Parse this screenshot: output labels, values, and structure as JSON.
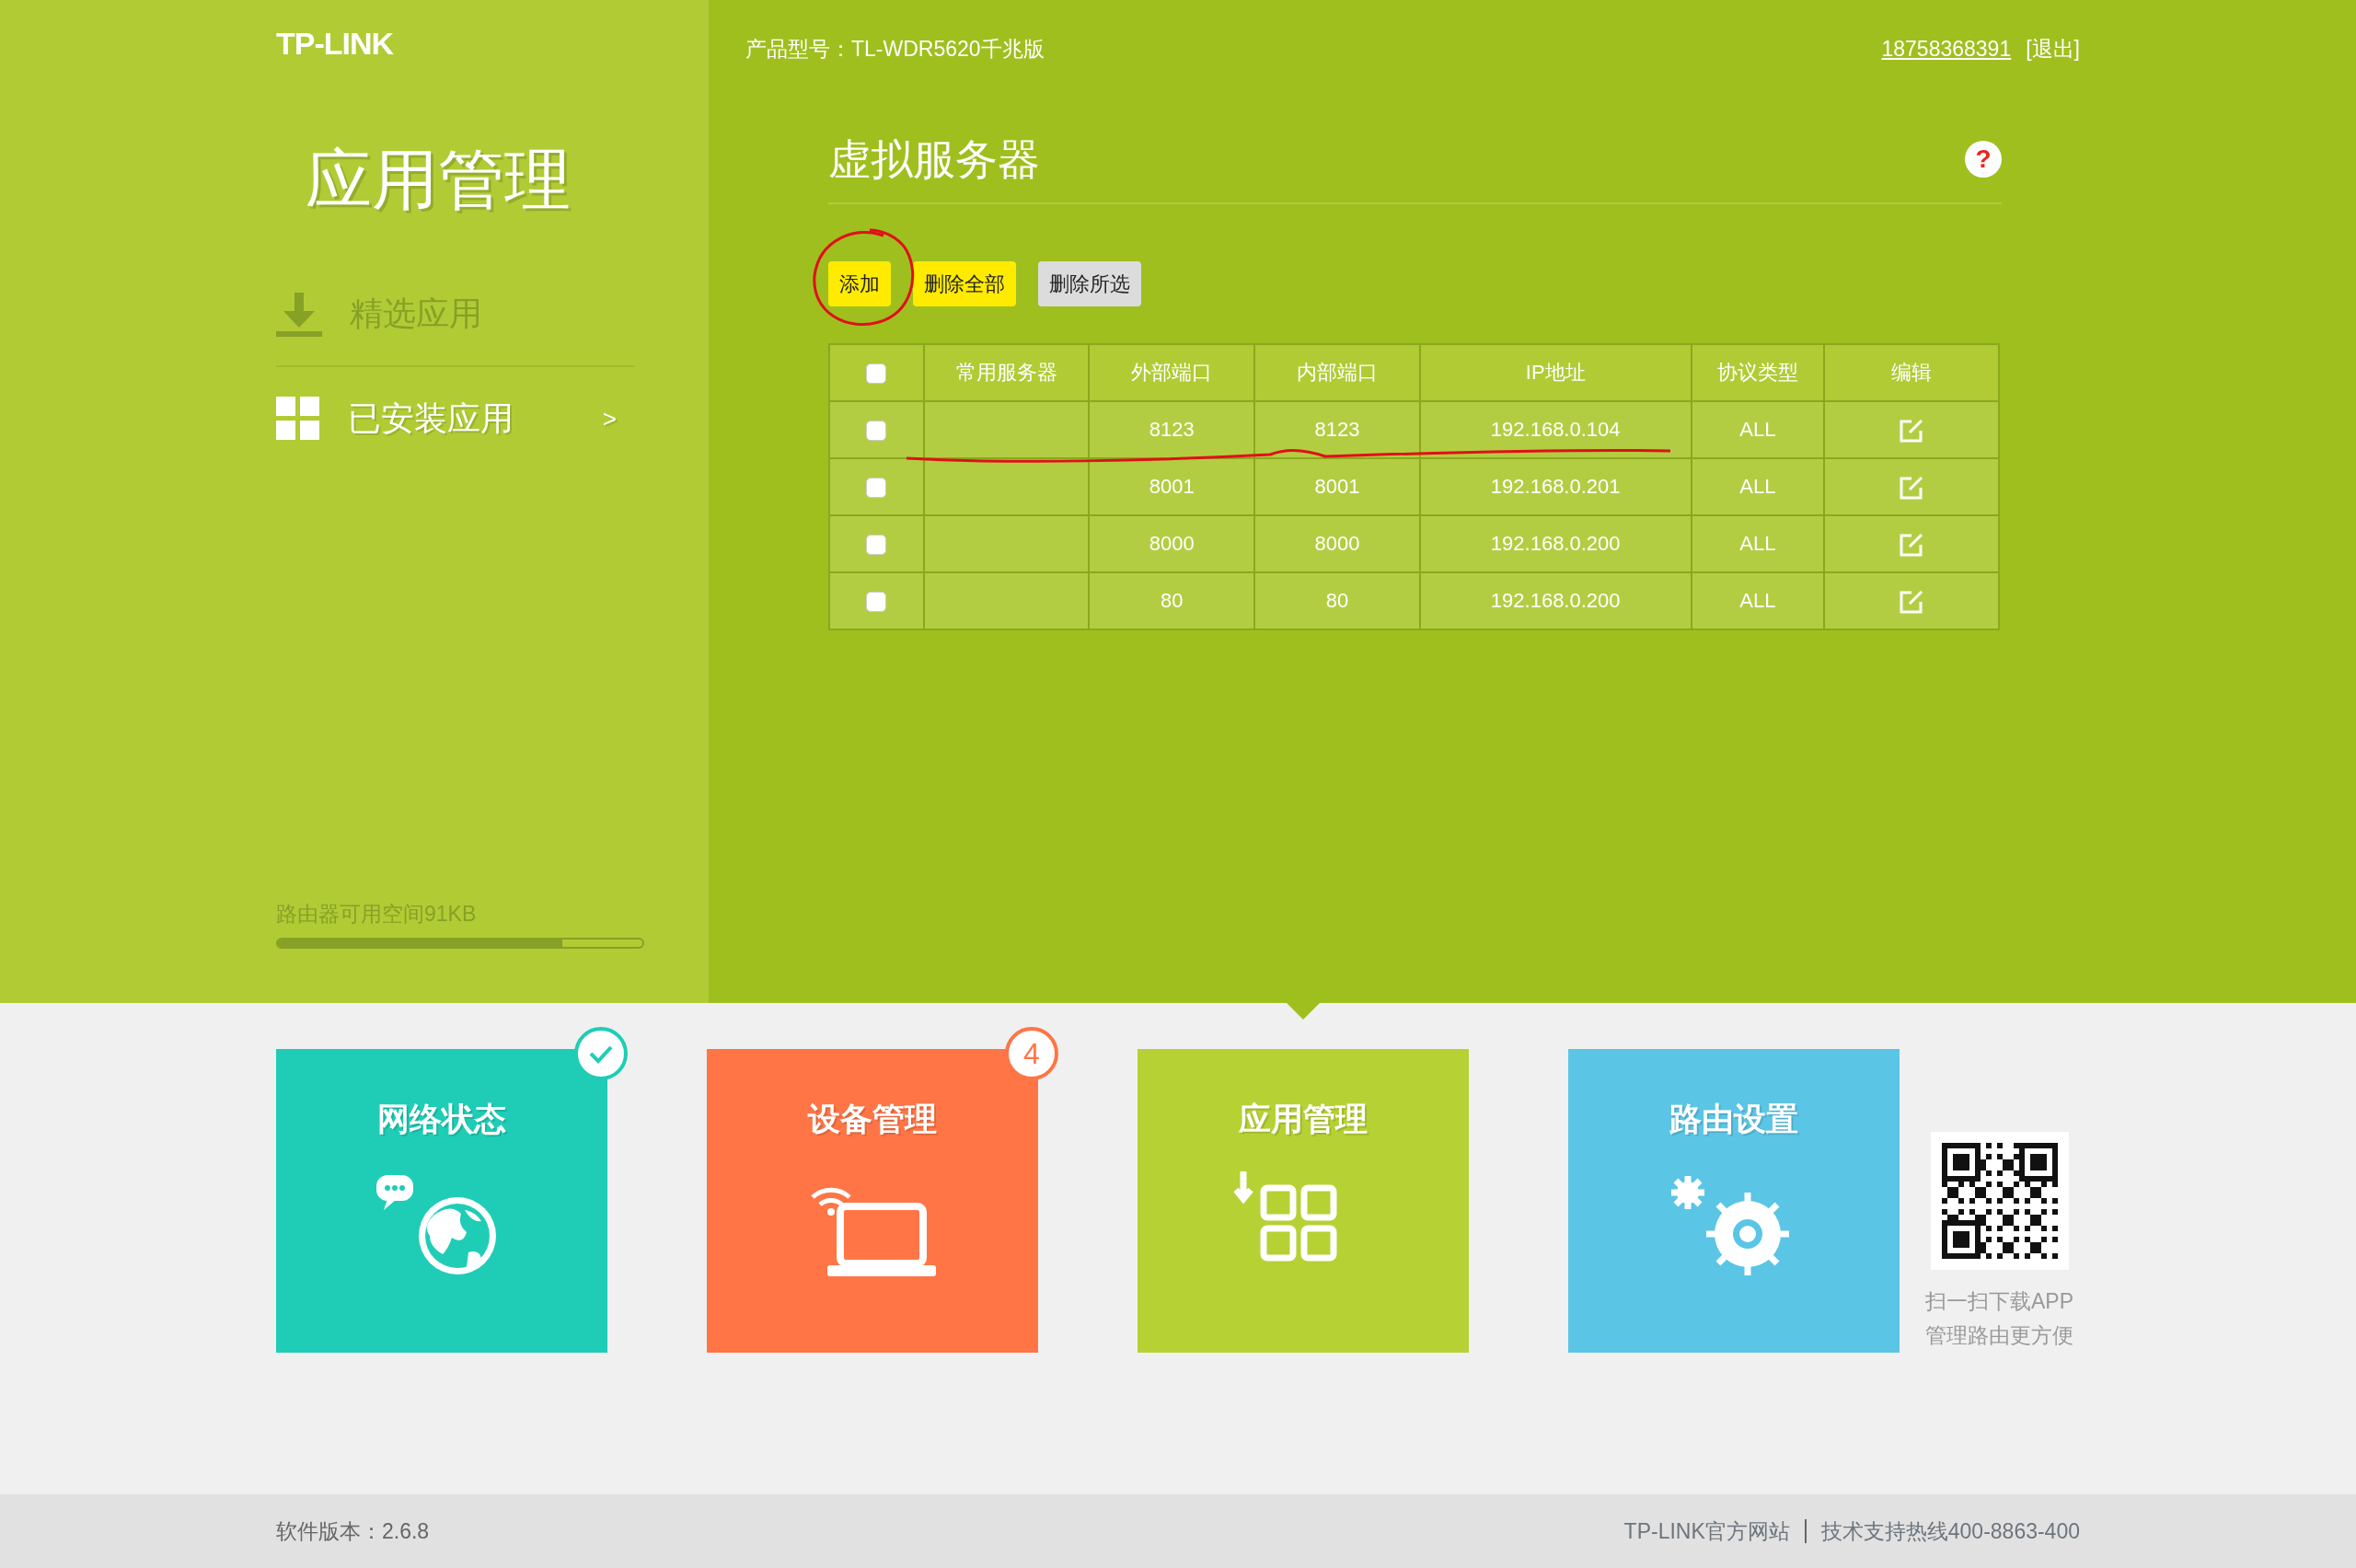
{
  "sidebar": {
    "logo": "TP-LINK",
    "title": "应用管理",
    "items": [
      {
        "label": "精选应用",
        "selected": false
      },
      {
        "label": "已安装应用",
        "selected": true,
        "arrow": ">"
      }
    ],
    "storage": {
      "text": "路由器可用空间91KB",
      "level": 0.78
    }
  },
  "header": {
    "model": "产品型号：TL-WDR5620千兆版",
    "account": "18758368391",
    "logout": "[退出]"
  },
  "section": {
    "title": "虚拟服务器",
    "help": "?"
  },
  "buttons": [
    {
      "label": "添加",
      "disabled": false
    },
    {
      "label": "删除全部",
      "disabled": false
    },
    {
      "label": "删除所选",
      "disabled": true
    }
  ],
  "table": {
    "select_all": {
      "checked": false
    },
    "columns": [
      "常用服务器",
      "外部端口",
      "内部端口",
      "IP地址",
      "协议类型",
      "编辑"
    ],
    "rows": [
      {
        "checked": false,
        "cells": [
          "",
          "8123",
          "8123",
          "192.168.0.104",
          "ALL"
        ]
      },
      {
        "checked": false,
        "cells": [
          "",
          "8001",
          "8001",
          "192.168.0.201",
          "ALL"
        ]
      },
      {
        "checked": false,
        "cells": [
          "",
          "8000",
          "8000",
          "192.168.0.200",
          "ALL"
        ]
      },
      {
        "checked": false,
        "cells": [
          "",
          "80",
          "80",
          "192.168.0.200",
          "ALL"
        ]
      }
    ]
  },
  "tiles": [
    {
      "label": "网络状态",
      "kind": "network",
      "color": "#1fcdb7",
      "selected": false,
      "badge": {
        "kind": "check"
      }
    },
    {
      "label": "设备管理",
      "kind": "device",
      "color": "#ff7546",
      "selected": false,
      "badge": {
        "kind": "count",
        "text": "4"
      }
    },
    {
      "label": "应用管理",
      "kind": "app",
      "color": "#b6d134",
      "selected": true
    },
    {
      "label": "路由设置",
      "kind": "router",
      "color": "#5bc5e6",
      "selected": false
    }
  ],
  "app_download": {
    "lines": [
      "扫一扫下载APP",
      "管理路由更方便"
    ]
  },
  "footer": {
    "version": "软件版本：2.6.8",
    "links": [
      "TP-LINK官方网站",
      "技术支持热线400-8863-400"
    ]
  }
}
